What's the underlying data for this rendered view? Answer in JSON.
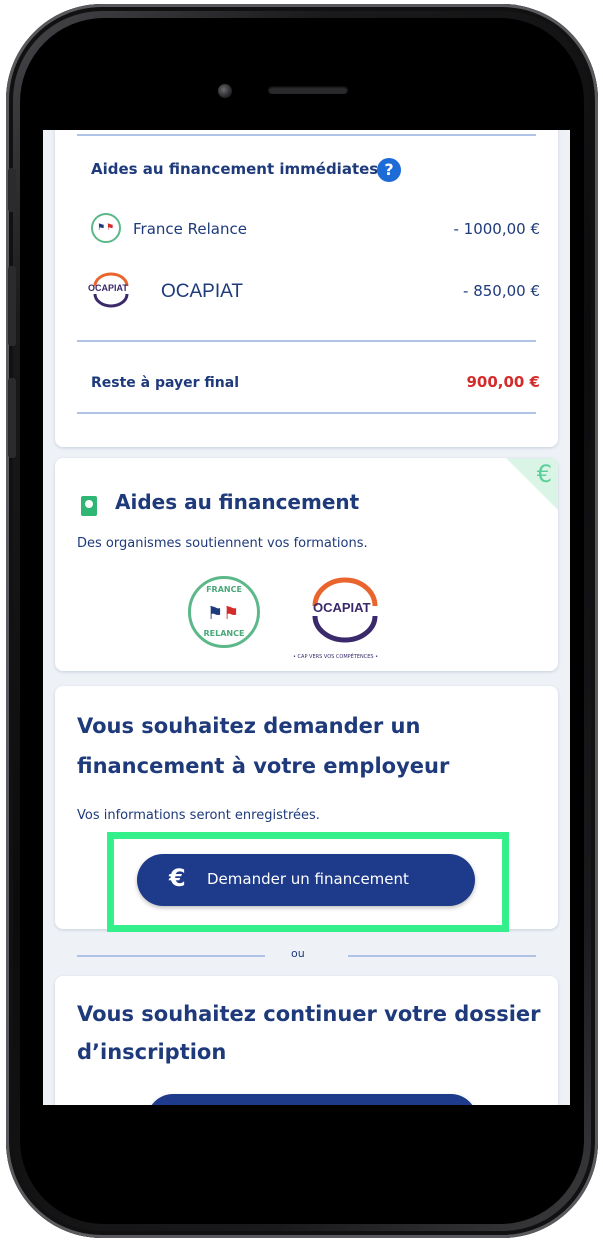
{
  "financing_summary": {
    "section_title": "Aides au financement immédiates",
    "help_glyph": "?",
    "rows": [
      {
        "name": "France Relance",
        "amount": "- 1000,00 €"
      },
      {
        "name": "OCAPIAT",
        "amount": "- 850,00 €"
      }
    ],
    "final_label": "Reste à payer final",
    "final_amount": "900,00 €"
  },
  "aid_card": {
    "title": "Aides au financement",
    "subtitle": "Des organismes soutiennent vos formations.",
    "corner_glyph": "€",
    "logos": {
      "france_relance": {
        "top_text": "FRANCE",
        "bottom_text": "RELANCE"
      },
      "ocapiat": {
        "name": "OCAPIAT",
        "tagline": "• CAP VERS VOS COMPÉTENCES •"
      }
    }
  },
  "employer_card": {
    "title_line1": "Vous souhaitez demander un",
    "title_line2": "financement à votre employeur",
    "note": "Vos informations seront enregistrées.",
    "button_label": "Demander un financement",
    "button_icon": "€"
  },
  "divider": {
    "label": "ou"
  },
  "continue_card": {
    "title_line1": "Vous souhaitez continuer votre dossier",
    "title_line2": "d’inscription"
  },
  "colors": {
    "navy": "#1e3a7b",
    "button": "#1e3a8a",
    "highlight": "#34f08a",
    "red": "#d42b2b",
    "green": "#2fb574"
  }
}
